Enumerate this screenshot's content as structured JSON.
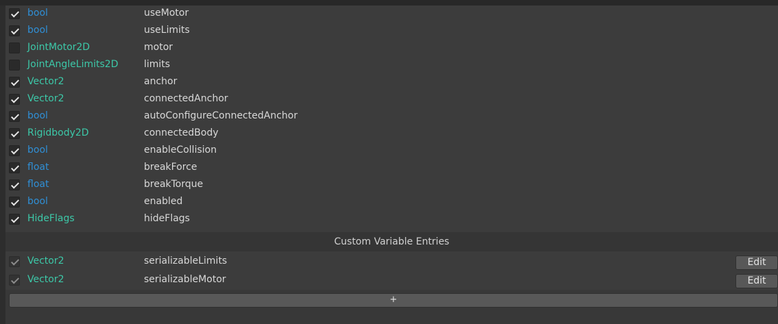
{
  "colors": {
    "type_blue": "#2f8fd6",
    "type_teal": "#3cc8a8",
    "background": "#383838"
  },
  "variables": [
    {
      "checked": true,
      "type": "bool",
      "name": "useMotor",
      "type_color": "blue"
    },
    {
      "checked": true,
      "type": "bool",
      "name": "useLimits",
      "type_color": "blue"
    },
    {
      "checked": false,
      "type": "JointMotor2D",
      "name": "motor",
      "type_color": "teal"
    },
    {
      "checked": false,
      "type": "JointAngleLimits2D",
      "name": "limits",
      "type_color": "teal"
    },
    {
      "checked": true,
      "type": "Vector2",
      "name": "anchor",
      "type_color": "teal"
    },
    {
      "checked": true,
      "type": "Vector2",
      "name": "connectedAnchor",
      "type_color": "teal"
    },
    {
      "checked": true,
      "type": "bool",
      "name": "autoConfigureConnectedAnchor",
      "type_color": "blue"
    },
    {
      "checked": true,
      "type": "Rigidbody2D",
      "name": "connectedBody",
      "type_color": "teal"
    },
    {
      "checked": true,
      "type": "bool",
      "name": "enableCollision",
      "type_color": "blue"
    },
    {
      "checked": true,
      "type": "float",
      "name": "breakForce",
      "type_color": "blue"
    },
    {
      "checked": true,
      "type": "float",
      "name": "breakTorque",
      "type_color": "blue"
    },
    {
      "checked": true,
      "type": "bool",
      "name": "enabled",
      "type_color": "blue"
    },
    {
      "checked": true,
      "type": "HideFlags",
      "name": "hideFlags",
      "type_color": "teal"
    }
  ],
  "custom_section": {
    "header": "Custom Variable Entries",
    "entries": [
      {
        "checked": true,
        "type": "Vector2",
        "name": "serializableLimits",
        "edit_label": "Edit",
        "type_color": "teal"
      },
      {
        "checked": true,
        "type": "Vector2",
        "name": "serializableMotor",
        "edit_label": "Edit",
        "type_color": "teal"
      }
    ],
    "add_label": "+"
  }
}
